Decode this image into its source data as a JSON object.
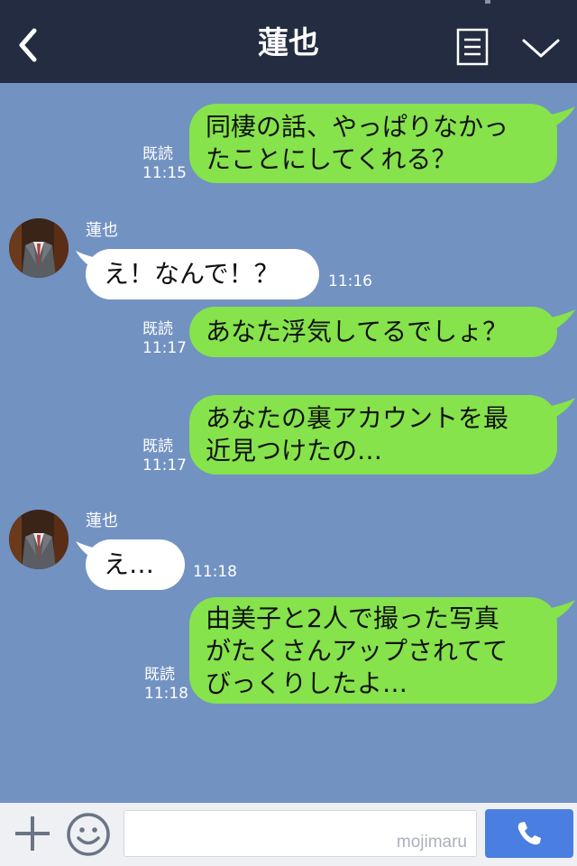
{
  "header": {
    "title": "蓮也",
    "back_icon": "chevron-left-icon",
    "menu_icon": "notes-icon",
    "more_icon": "chevron-down-icon"
  },
  "contact": {
    "name": "蓮也",
    "avatar": "suit-portrait"
  },
  "messages": [
    {
      "side": "sent",
      "lines": [
        "同棲の話、やっぱりなかっ",
        "たことにしてくれる？"
      ],
      "read": "既読",
      "time": "11:15"
    },
    {
      "side": "received",
      "sender": "蓮也",
      "lines": [
        "え！なんで！？"
      ],
      "time": "11:16"
    },
    {
      "side": "sent",
      "lines": [
        "あなた浮気してるでしょ？"
      ],
      "read": "既読",
      "time": "11:17"
    },
    {
      "side": "sent",
      "lines": [
        "あなたの裏アカウントを最",
        "近見つけたの…"
      ],
      "read": "既読",
      "time": "11:17"
    },
    {
      "side": "received",
      "sender": "蓮也",
      "lines": [
        "え…"
      ],
      "time": "11:18"
    },
    {
      "side": "sent",
      "lines": [
        "由美子と2人で撮った写真",
        "がたくさんアップされてて",
        "びっくりしたよ…"
      ],
      "read": "既読",
      "time": "11:18"
    }
  ],
  "input_bar": {
    "plus_icon": "plus-icon",
    "emoji_icon": "smiley-icon",
    "message_value": "",
    "watermark": "mojimaru",
    "call_icon": "phone-icon"
  },
  "colors": {
    "header_bg": "#232c41",
    "chat_bg": "#7292c2",
    "sent_bubble": "#86e34b",
    "received_bubble": "#ffffff",
    "call_button": "#4a7ee0"
  }
}
